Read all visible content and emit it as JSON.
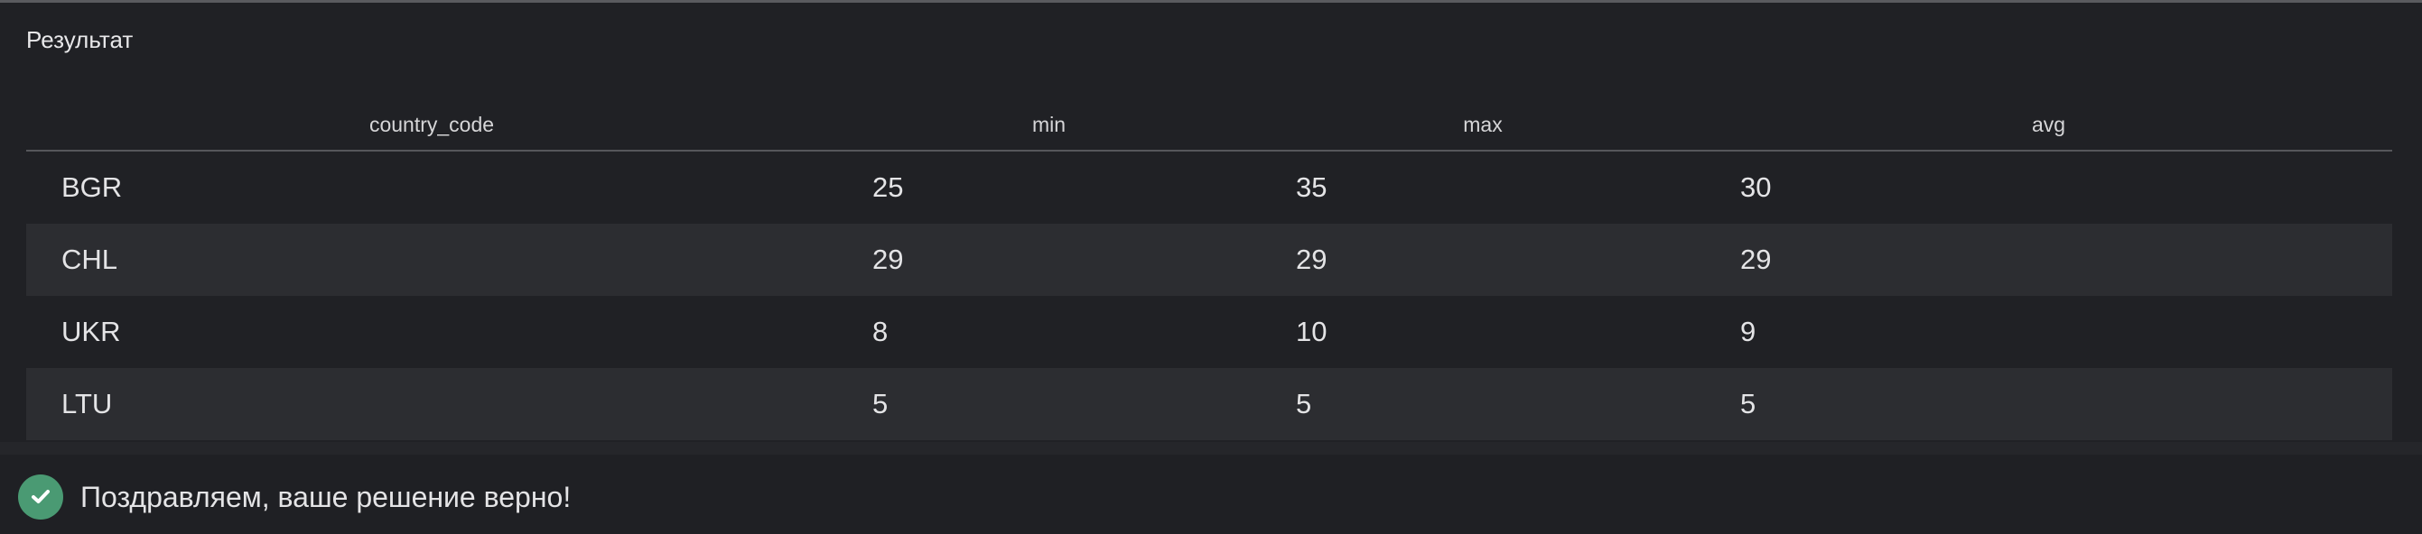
{
  "result": {
    "title": "Результат",
    "columns": [
      "country_code",
      "min",
      "max",
      "avg"
    ],
    "rows": [
      [
        "BGR",
        "25",
        "35",
        "30"
      ],
      [
        "CHL",
        "29",
        "29",
        "29"
      ],
      [
        "UKR",
        "8",
        "10",
        "9"
      ],
      [
        "LTU",
        "5",
        "5",
        "5"
      ]
    ]
  },
  "status": {
    "icon": "check-circle-icon",
    "message": "Поздравляем, ваше решение верно!",
    "color": "#4a9a73"
  }
}
